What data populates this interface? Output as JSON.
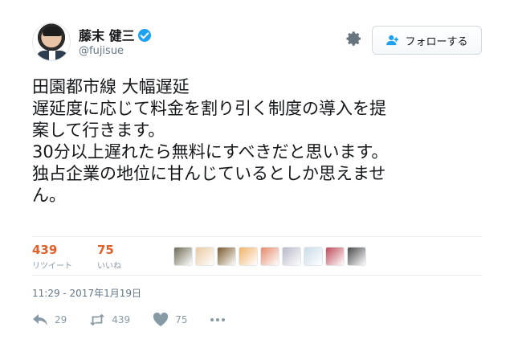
{
  "user": {
    "name": "藤末 健三",
    "handle": "@fujisue"
  },
  "follow_button": {
    "label": "フォローする"
  },
  "tweet": {
    "lines": [
      "田園都市線 大幅遅延",
      "遅延度に応じて料金を割り引く制度の導入を提",
      "案して行きます。",
      "30分以上遅れたら無料にすべきだと思います。",
      "独占企業の地位に甘んじているとしか思えませ",
      "ん。"
    ],
    "timestamp": "11:29 - 2017年1月19日"
  },
  "stats": {
    "retweets": {
      "count": "439",
      "label": "リツイート"
    },
    "likes": {
      "count": "75",
      "label": "いいね"
    }
  },
  "likers": [
    {
      "name": "liker-1",
      "color": "#6f6a55"
    },
    {
      "name": "liker-2",
      "color": "#e9c9a0"
    },
    {
      "name": "liker-3",
      "color": "#7a5a2c"
    },
    {
      "name": "liker-4",
      "color": "#f0b36a"
    },
    {
      "name": "liker-5",
      "color": "#e58a6a"
    },
    {
      "name": "liker-6",
      "color": "#b8b8c8"
    },
    {
      "name": "liker-7",
      "color": "#c9dbe6"
    },
    {
      "name": "liker-8",
      "color": "#c04a5a"
    },
    {
      "name": "liker-9",
      "color": "#4a4a4a"
    }
  ],
  "actions": {
    "reply": {
      "count": "29",
      "icon": "reply-icon"
    },
    "retweet": {
      "count": "439",
      "icon": "retweet-icon"
    },
    "like": {
      "count": "75",
      "icon": "heart-icon"
    },
    "more": {
      "icon": "more-icon"
    }
  },
  "colors": {
    "accent": "#e0602b",
    "verified": "#1da1f2",
    "muted": "#8899a6"
  }
}
